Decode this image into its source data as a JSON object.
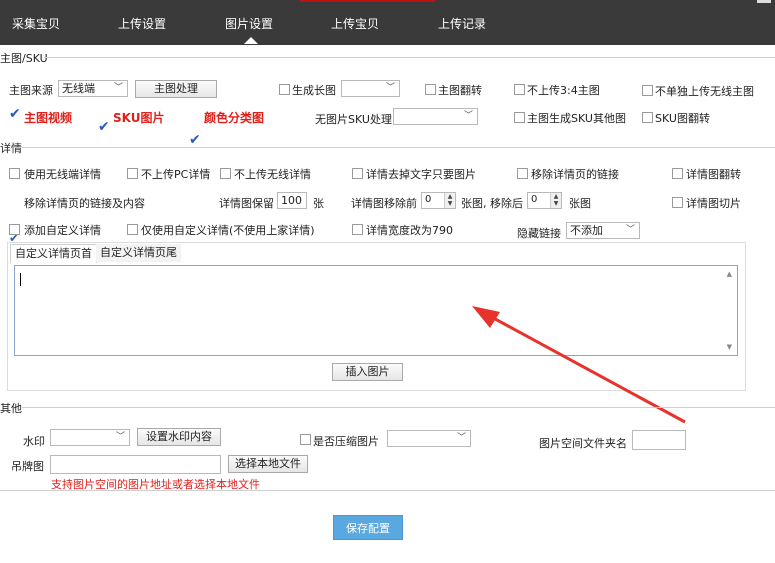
{
  "nav": {
    "tabs": [
      {
        "label": "采集宝贝"
      },
      {
        "label": "上传设置"
      },
      {
        "label": "图片设置"
      },
      {
        "label": "上传宝贝"
      },
      {
        "label": "上传记录"
      }
    ],
    "active_tab": "图片设置"
  },
  "main_image": {
    "section_title": "主图/SKU",
    "source_label": "主图来源",
    "source_value": "无线端",
    "process_button": "主图处理",
    "gen_long_image": {
      "label": "生成长图",
      "checked": false,
      "select_value": ""
    },
    "flip_main": {
      "label": "主图翻转",
      "checked": false
    },
    "no_upload_34": {
      "label": "不上传3:4主图",
      "checked": false
    },
    "no_separate_wireless": {
      "label": "不单独上传无线主图",
      "checked": false
    },
    "main_video": {
      "label": "主图视频",
      "checked": true
    },
    "sku_image": {
      "label": "SKU图片",
      "checked": true
    },
    "color_category": {
      "label": "颜色分类图",
      "checked": true
    },
    "no_sku_image_label": "无图片SKU处理",
    "no_sku_image_value": "",
    "main_gen_sku_other": {
      "label": "主图生成SKU其他图",
      "checked": false
    },
    "sku_flip": {
      "label": "SKU图翻转",
      "checked": false
    }
  },
  "details": {
    "section_title": "详情",
    "use_wireless": {
      "label": "使用无线端详情",
      "checked": false
    },
    "no_pc": {
      "label": "不上传PC详情",
      "checked": false
    },
    "no_wireless": {
      "label": "不上传无线详情",
      "checked": false
    },
    "strip_text": {
      "label": "详情去掉文字只要图片",
      "checked": false
    },
    "remove_links": {
      "label": "移除详情页的链接",
      "checked": false
    },
    "flip_detail": {
      "label": "详情图翻转",
      "checked": false
    },
    "remove_links_content": {
      "label": "移除详情页的链接及内容",
      "checked": true
    },
    "keep_label": "详情图保留",
    "keep_value": "100",
    "keep_unit": "张",
    "remove_front_label": "详情图移除前",
    "remove_front_value": "0",
    "remove_back_label": "张图, 移除后",
    "remove_back_value": "0",
    "remove_unit": "张图",
    "cut_detail": {
      "label": "详情图切片",
      "checked": false
    },
    "add_custom": {
      "label": "添加自定义详情",
      "checked": false
    },
    "only_custom": {
      "label": "仅使用自定义详情(不使用上家详情)",
      "checked": false
    },
    "width_790": {
      "label": "详情宽度改为790",
      "checked": false
    },
    "hidden_link_label": "隐藏链接",
    "hidden_link_value": "不添加",
    "subtabs": [
      {
        "label": "自定义详情页首"
      },
      {
        "label": "自定义详情页尾"
      }
    ],
    "textarea_value": "",
    "insert_image_button": "插入图片"
  },
  "other": {
    "section_title": "其他",
    "watermark_label": "水印",
    "watermark_value": "",
    "watermark_button": "设置水印内容",
    "compress": {
      "label": "是否压缩图片",
      "checked": false
    },
    "compress_value": "",
    "folder_label": "图片空间文件夹名",
    "folder_value": "",
    "tag_label": "吊牌图",
    "tag_value": "",
    "tag_button": "选择本地文件",
    "tag_hint": "支持图片空间的图片地址或者选择本地文件"
  },
  "save_button": "保存配置",
  "colors": {
    "topbar": "#3a3a3a",
    "accent_red": "#e0201b",
    "save_blue": "#5aa8e0",
    "annotation_arrow": "#e8322c"
  }
}
